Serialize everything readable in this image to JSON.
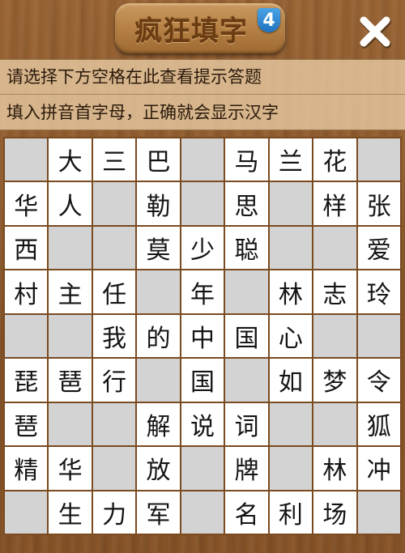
{
  "header": {
    "title": "疯狂填字",
    "level_badge": "4",
    "close_icon": "close-x-icon"
  },
  "hints": {
    "line1": "请选择下方空格在此查看提示答题",
    "line2": "填入拼音首字母，正确就会显示汉字"
  },
  "colors": {
    "filled_cell": "#ffffff",
    "empty_cell": "#d3d3d3",
    "title_text": "#6b3c12",
    "badge": "#2a86d6"
  },
  "grid": [
    [
      "",
      "大",
      "三",
      "巴",
      "",
      "马",
      "兰",
      "花",
      ""
    ],
    [
      "华",
      "人",
      "",
      "勒",
      "",
      "思",
      "",
      "样",
      "张"
    ],
    [
      "西",
      "",
      "",
      "莫",
      "少",
      "聪",
      "",
      "",
      "爱"
    ],
    [
      "村",
      "主",
      "任",
      "",
      "年",
      "",
      "林",
      "志",
      "玲"
    ],
    [
      "",
      "",
      "我",
      "的",
      "中",
      "国",
      "心",
      "",
      ""
    ],
    [
      "琵",
      "琶",
      "行",
      "",
      "国",
      "",
      "如",
      "梦",
      "令"
    ],
    [
      "琶",
      "",
      "",
      "解",
      "说",
      "词",
      "",
      "",
      "狐"
    ],
    [
      "精",
      "华",
      "",
      "放",
      "",
      "牌",
      "",
      "林",
      "冲"
    ],
    [
      "",
      "生",
      "力",
      "军",
      "",
      "名",
      "利",
      "场",
      ""
    ]
  ]
}
